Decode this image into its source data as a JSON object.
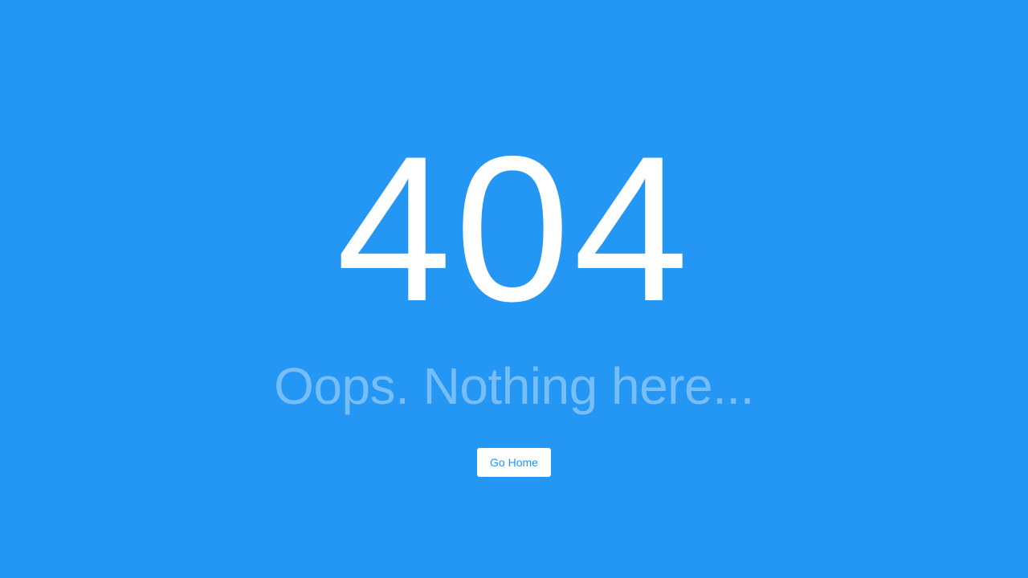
{
  "page": {
    "background_color": "#2496f4",
    "error_code": "404",
    "message": "Oops. Nothing here...",
    "button": {
      "label": "Go Home",
      "text_color": "#2196f3",
      "background_color": "#ffffff"
    }
  }
}
